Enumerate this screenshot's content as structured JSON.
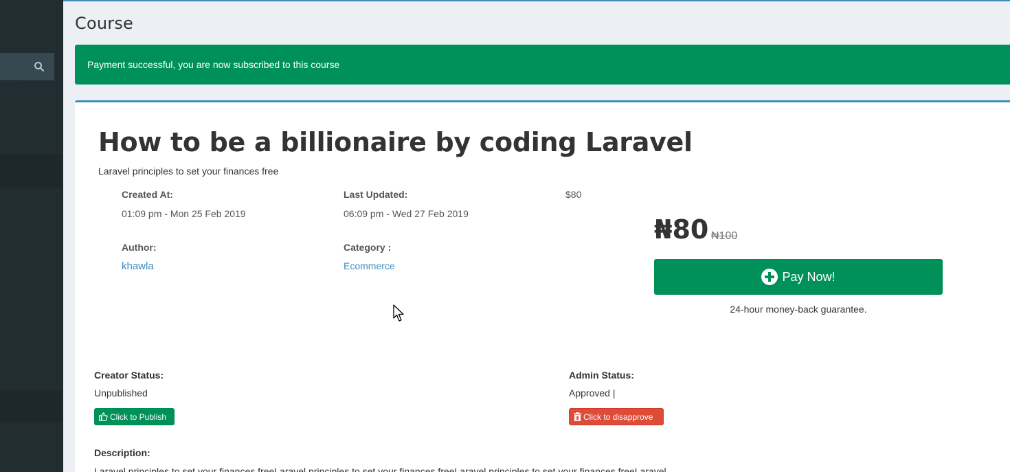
{
  "page": {
    "title": "Course"
  },
  "alert": {
    "message": "Payment successful, you are now subscribed to this course"
  },
  "sidebar": {
    "search_icon": "search-icon"
  },
  "course": {
    "title": "How to be a billionaire by coding Laravel",
    "subtitle": "Laravel principles to set your finances free",
    "created_label": "Created At:",
    "created_value": "01:09 pm - Mon 25 Feb 2019",
    "updated_label": "Last Updated:",
    "updated_value": "06:09 pm - Wed 27 Feb 2019",
    "small_price": "$80",
    "author_label": "Author:",
    "author_value": "khawla",
    "category_label": "Category :",
    "category_value": "Ecommerce"
  },
  "pricing": {
    "price": "₦80",
    "old_price": "₦100",
    "pay_label": "Pay Now!",
    "guarantee": "24-hour money-back guarantee."
  },
  "status": {
    "creator_label": "Creator Status:",
    "creator_value": "Unpublished",
    "publish_button": "Click to Publish",
    "admin_label": "Admin Status:",
    "admin_value": "Approved |",
    "disapprove_button": "Click to disapprove"
  },
  "description": {
    "label": "Description:",
    "text": "Laravel principles to set your finances freeLaravel principles to set your finances freeLaravel principles to set your finances freeLaravel"
  },
  "colors": {
    "success": "#00915a",
    "danger": "#dd4b39",
    "link": "#3c8dbc",
    "sidebar": "#222d32"
  }
}
